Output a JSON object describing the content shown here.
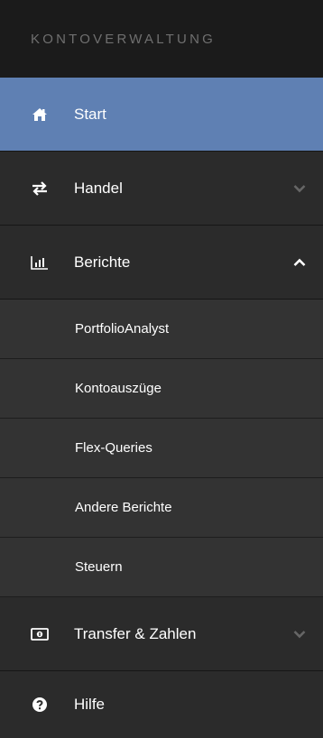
{
  "header": {
    "title": "KONTOVERWALTUNG"
  },
  "nav": {
    "start": {
      "label": "Start",
      "icon": "home-icon"
    },
    "handel": {
      "label": "Handel",
      "icon": "transfer-arrows-icon"
    },
    "berichte": {
      "label": "Berichte",
      "icon": "bar-chart-icon"
    },
    "berichte_sub": [
      {
        "label": "PortfolioAnalyst"
      },
      {
        "label": "Kontoauszüge"
      },
      {
        "label": "Flex-Queries"
      },
      {
        "label": "Andere Berichte"
      },
      {
        "label": "Steuern"
      }
    ],
    "transfer": {
      "label": "Transfer & Zahlen",
      "icon": "money-icon"
    },
    "hilfe": {
      "label": "Hilfe",
      "icon": "question-icon"
    }
  },
  "colors": {
    "active": "#5f80b3",
    "header_bg": "#1b1b1b",
    "item_bg": "#2b2b2b",
    "sub_bg": "#333333"
  }
}
